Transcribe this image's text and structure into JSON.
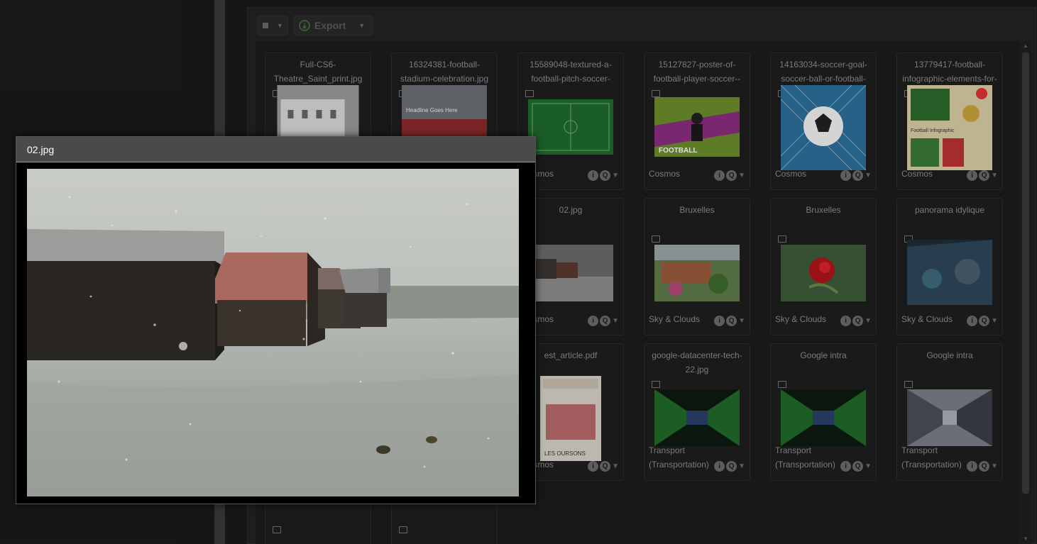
{
  "toolbar": {
    "export_label": "Export"
  },
  "tiles": [
    {
      "title": "Full-CS6-Theatre_Saint_print.jpg",
      "tag": ""
    },
    {
      "title": "16324381-football-stadium-celebration.jpg",
      "tag": ""
    },
    {
      "title": "15589048-textured-a-football-pitch-soccer-",
      "tag": "Cosmos"
    },
    {
      "title": "15127827-poster-of-football-player-soccer--",
      "tag": "Cosmos"
    },
    {
      "title": "14163034-soccer-goal-soccer-ball-or-football-",
      "tag": "Cosmos"
    },
    {
      "title": "13779417-football-infographic-elements-for-",
      "tag": "Cosmos"
    },
    {
      "title": "02.jpg",
      "tag": "Cosmos"
    },
    {
      "title": "Bruxelles",
      "tag": "Sky & Clouds"
    },
    {
      "title": "Bruxelles",
      "tag": "Sky & Clouds"
    },
    {
      "title": "panorama idylique",
      "tag": "Sky & Clouds"
    },
    {
      "title": "est_article.pdf",
      "tag": "Cosmos"
    },
    {
      "title": "google-datacenter-tech-22.jpg",
      "tag": "Transport (Transportation)"
    },
    {
      "title": "Google intra",
      "tag": "Transport (Transportation)"
    },
    {
      "title": "Google intra",
      "tag": "Transport (Transportation)"
    }
  ],
  "thumb_texts": {
    "stadium": "Headline Goes Here",
    "poster": "FOOTBALL",
    "infographic": "Football Infographic",
    "article": "LES OURSONS"
  },
  "actions": {
    "info": "i",
    "zoom": "Q",
    "menu": "▼"
  },
  "preview": {
    "title": "02.jpg"
  }
}
